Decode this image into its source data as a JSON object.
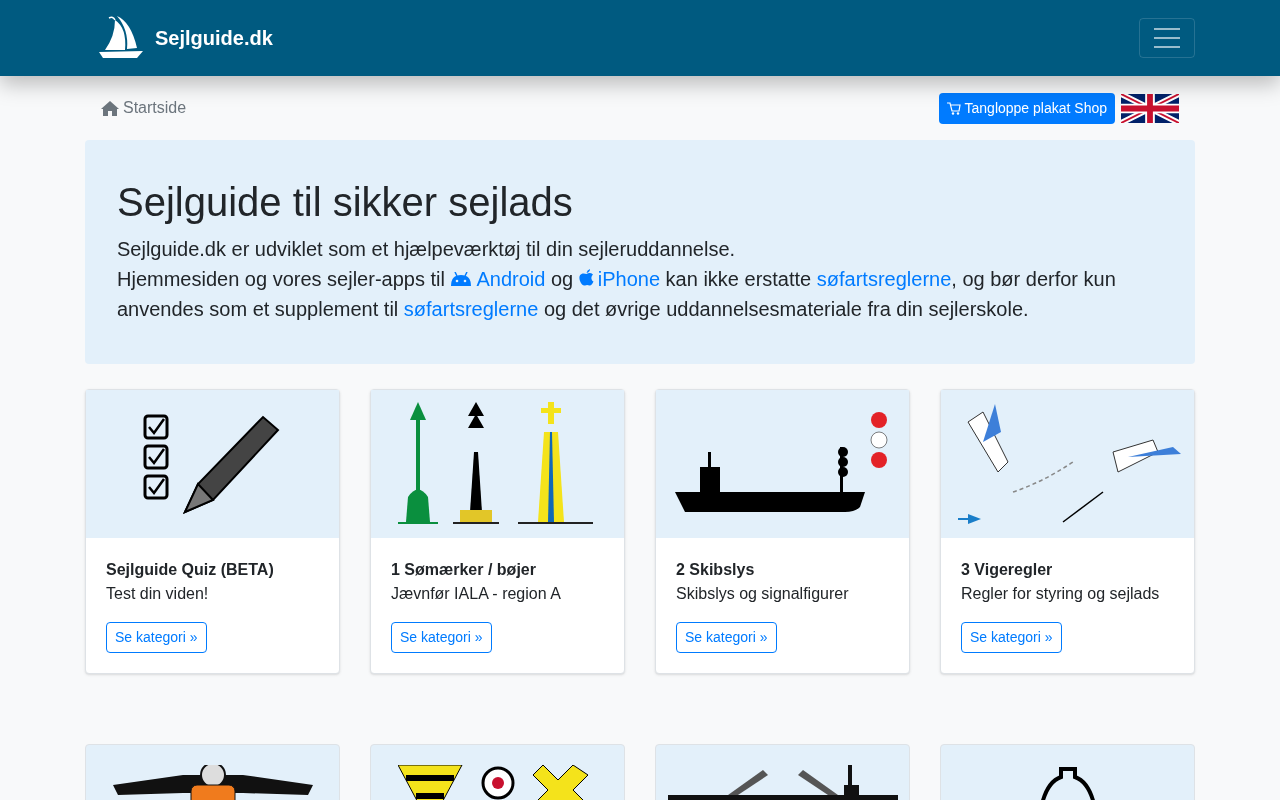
{
  "navbar": {
    "brand": "Sejlguide.dk"
  },
  "breadcrumb": {
    "label": "Startside"
  },
  "shop_button": {
    "label": "Tangloppe plakat Shop"
  },
  "intro": {
    "title": "Sejlguide til sikker sejlads",
    "lead": "Sejlguide.dk er udviklet som et hjælpeværktøj til din sejleruddannelse.",
    "segments": [
      {
        "kind": "text",
        "text": "Hjemmesiden og vores sejler-apps til "
      },
      {
        "kind": "android_link",
        "text": "Android"
      },
      {
        "kind": "text",
        "text": " og "
      },
      {
        "kind": "apple_link",
        "text": "iPhone"
      },
      {
        "kind": "text",
        "text": " kan ikke erstatte "
      },
      {
        "kind": "link",
        "text": "søfartsreglerne"
      },
      {
        "kind": "text",
        "text": ", og bør derfor kun anvendes som et supplement til "
      },
      {
        "kind": "link",
        "text": "søfartsreglerne"
      },
      {
        "kind": "text",
        "text": " og det øvrige uddannelsesmateriale fra din sejlerskole."
      }
    ]
  },
  "cards": [
    {
      "kind": "full",
      "title": "Sejlguide Quiz (BETA)",
      "subtitle": "Test din viden!",
      "button": "Se kategori »"
    },
    {
      "kind": "full",
      "title": "1 Sømærker / bøjer",
      "subtitle": "Jævnfør IALA - region A",
      "button": "Se kategori »"
    },
    {
      "kind": "full",
      "title": "2 Skibslys",
      "subtitle": "Skibslys og signalfigurer",
      "button": "Se kategori »"
    },
    {
      "kind": "full",
      "title": "3 Vigeregler",
      "subtitle": "Regler for styring og sejlads",
      "button": "Se kategori »"
    },
    {
      "kind": "cut_off"
    },
    {
      "kind": "cut_off"
    },
    {
      "kind": "cut_off"
    },
    {
      "kind": "cut_off"
    }
  ]
}
